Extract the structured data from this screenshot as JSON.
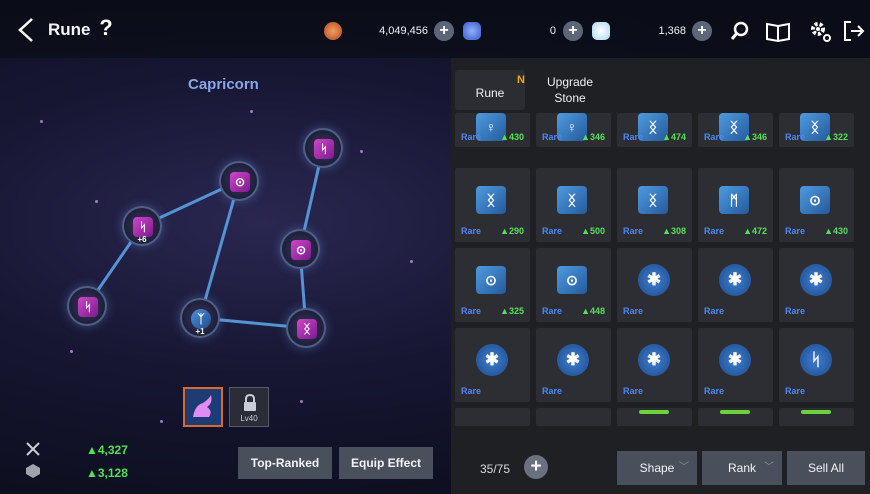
{
  "header": {
    "title": "Rune",
    "help_label": "?",
    "currency_gold": "4,049,456",
    "currency_blue": "0",
    "currency_crystal": "1,368",
    "plus_label": "+"
  },
  "constellation": {
    "title": "Capricorn",
    "nodes": [
      {
        "glyph": "ᛋ",
        "level": ""
      },
      {
        "glyph": "ᛋ",
        "level": "+6"
      },
      {
        "glyph": "⊙",
        "level": ""
      },
      {
        "glyph": "ᛋ",
        "level": ""
      },
      {
        "glyph": "⊙",
        "level": ""
      },
      {
        "glyph": "ᛉ",
        "level": "+1"
      },
      {
        "glyph": "ᛝ",
        "level": ""
      }
    ],
    "lock_level": "Lv40"
  },
  "stats": {
    "attack": "▲4,327",
    "defense": "▲3,128"
  },
  "buttons": {
    "top_ranked": "Top-Ranked",
    "equip_effect": "Equip Effect"
  },
  "tabs": {
    "rune": "Rune",
    "rune_badge": "N",
    "upgrade_line1": "Upgrade",
    "upgrade_line2": "Stone"
  },
  "inventory": {
    "count": "35/75",
    "add_label": "+",
    "shape_label": "Shape",
    "rank_label": "Rank",
    "sell_all_label": "Sell All",
    "rows": [
      [
        {
          "glyph": "♀",
          "grade": "Rare",
          "score": "▲430"
        },
        {
          "glyph": "♀",
          "grade": "Rare",
          "score": "▲346"
        },
        {
          "glyph": "ᛝ",
          "grade": "Rare",
          "score": "▲474"
        },
        {
          "glyph": "ᛝ",
          "grade": "Rare",
          "score": "▲346"
        },
        {
          "glyph": "ᛝ",
          "grade": "Rare",
          "score": "▲322"
        }
      ],
      [
        {
          "glyph": "ᛝ",
          "grade": "Rare",
          "score": "▲290"
        },
        {
          "glyph": "ᛝ",
          "grade": "Rare",
          "score": "▲500"
        },
        {
          "glyph": "ᛝ",
          "grade": "Rare",
          "score": "▲308"
        },
        {
          "glyph": "ᛗ",
          "grade": "Rare",
          "score": "▲472"
        },
        {
          "glyph": "⊙",
          "grade": "Rare",
          "score": "▲430"
        }
      ],
      [
        {
          "glyph": "⊙",
          "grade": "Rare",
          "score": "▲325"
        },
        {
          "glyph": "⊙",
          "grade": "Rare",
          "score": "▲448"
        },
        {
          "glyph": "✱",
          "grade": "Rare",
          "score": ""
        },
        {
          "glyph": "✱",
          "grade": "Rare",
          "score": ""
        },
        {
          "glyph": "✱",
          "grade": "Rare",
          "score": ""
        }
      ],
      [
        {
          "glyph": "✱",
          "grade": "Rare",
          "score": ""
        },
        {
          "glyph": "✱",
          "grade": "Rare",
          "score": ""
        },
        {
          "glyph": "✱",
          "grade": "Rare",
          "score": ""
        },
        {
          "glyph": "✱",
          "grade": "Rare",
          "score": ""
        },
        {
          "glyph": "ᛋ",
          "grade": "Rare",
          "score": ""
        }
      ]
    ]
  },
  "colors": {
    "accent_green": "#53e052",
    "rare_blue": "#4d88f0",
    "badge_orange": "#f0a51c"
  }
}
